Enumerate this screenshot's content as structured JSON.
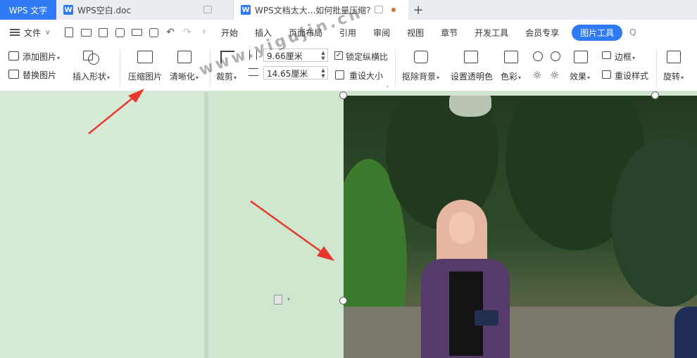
{
  "titlebar": {
    "app_tab": "WPS 文字",
    "tab1": "WPS空白.doc",
    "tab2": "WPS文档太大...如何批量压缩?",
    "w_letter": "W",
    "plus": "+"
  },
  "menubar": {
    "file_label": "文件",
    "items": [
      "开始",
      "插入",
      "页面布局",
      "引用",
      "审阅",
      "视图",
      "章节",
      "开发工具",
      "会员专享"
    ],
    "active_tab": "图片工具",
    "search_label": "Q",
    "chevron": "∨"
  },
  "ribbon": {
    "add_picture": "添加图片",
    "replace_picture": "替换图片",
    "insert_shape": "插入形状",
    "compress_picture": "压缩图片",
    "sharpen": "清晰化",
    "crop": "裁剪",
    "height_value": "9.66厘米",
    "width_value": "14.65厘米",
    "lock_ratio": "锁定纵横比",
    "reset_size": "重设大小",
    "remove_background": "抠除背景",
    "set_transparent": "设置透明色",
    "color": "色彩",
    "effects": "效果",
    "border": "边框",
    "reset_style": "重设样式",
    "rotate": "旋转",
    "caret": "▾",
    "check": "✓",
    "spin_arrows": "▲▼"
  },
  "document": {
    "watermark": "www.yigujin.cn"
  },
  "colors": {
    "accent": "#2f7bf5",
    "page_bg": "#cfe6cf",
    "arrow": "#e8372c"
  }
}
